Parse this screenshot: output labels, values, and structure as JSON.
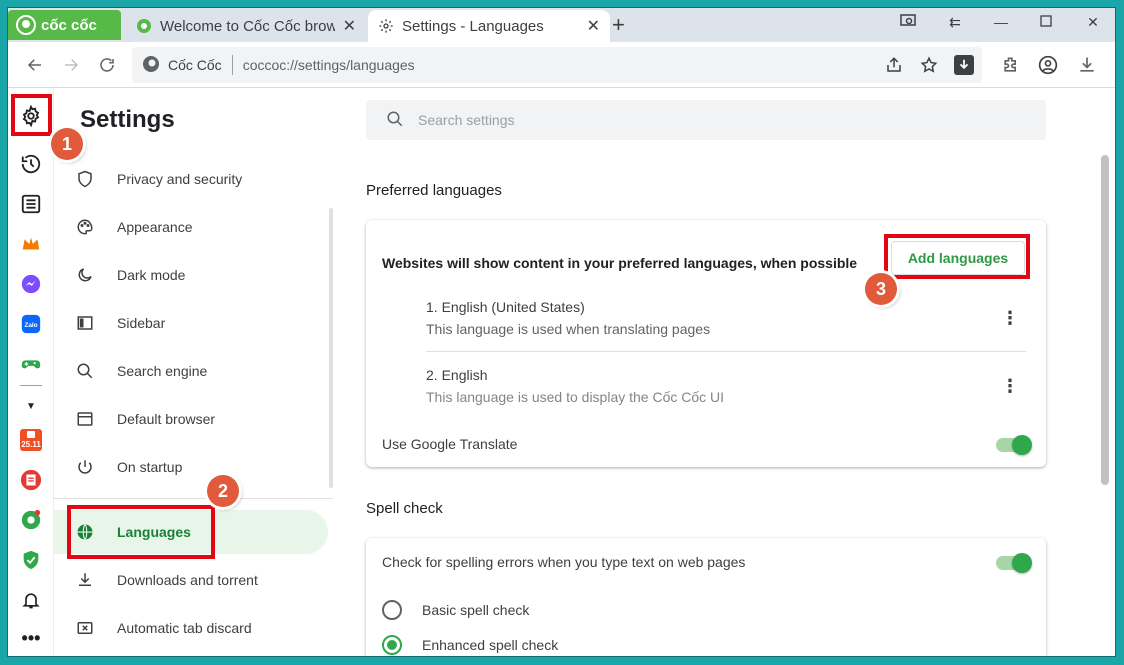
{
  "browser": {
    "brand": "cốc cốc",
    "tabs": [
      {
        "title": "Welcome to Cốc Cốc browse",
        "active": false
      },
      {
        "title": "Settings - Languages",
        "active": true
      }
    ],
    "omnibox": {
      "site": "Cốc Cốc",
      "url": "coccoc://settings/languages"
    }
  },
  "settings": {
    "title": "Settings",
    "search_placeholder": "Search settings",
    "nav": [
      {
        "label": "Privacy and security",
        "icon": "shield-icon"
      },
      {
        "label": "Appearance",
        "icon": "palette-icon"
      },
      {
        "label": "Dark mode",
        "icon": "moon-icon"
      },
      {
        "label": "Sidebar",
        "icon": "sidebar-icon"
      },
      {
        "label": "Search engine",
        "icon": "search-icon"
      },
      {
        "label": "Default browser",
        "icon": "browser-icon"
      },
      {
        "label": "On startup",
        "icon": "power-icon"
      },
      {
        "label": "Languages",
        "icon": "globe-icon",
        "selected": true
      },
      {
        "label": "Downloads and torrent",
        "icon": "download-icon"
      },
      {
        "label": "Automatic tab discard",
        "icon": "tab-discard-icon"
      }
    ]
  },
  "preferred": {
    "section_title": "Preferred languages",
    "heading": "Websites will show content in your preferred languages, when possible",
    "add_button": "Add languages",
    "languages": [
      {
        "name": "1. English (United States)",
        "note": "This language is used when translating pages"
      },
      {
        "name": "2. English",
        "note": "This language is used to display the Cốc Cốc UI"
      }
    ],
    "translate_label": "Use Google Translate",
    "translate_on": true
  },
  "spell": {
    "section_title": "Spell check",
    "check_label": "Check for spelling errors when you type text on web pages",
    "check_on": true,
    "options": [
      {
        "label": "Basic spell check",
        "checked": false
      },
      {
        "label": "Enhanced spell check",
        "checked": true
      }
    ]
  },
  "annotations": {
    "step1": "1",
    "step2": "2",
    "step3": "3"
  },
  "colors": {
    "highlight": "#e30613",
    "badge": "#e05a3b",
    "accent": "#2e9a45",
    "brand": "#57b947"
  }
}
